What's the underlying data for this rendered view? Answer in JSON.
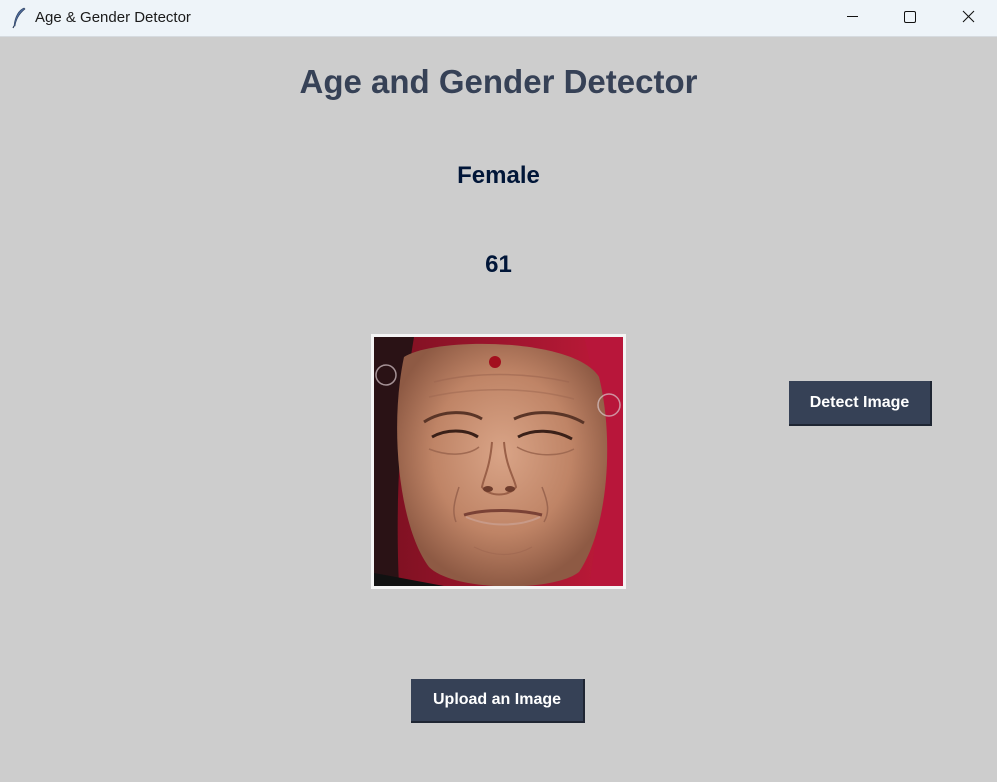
{
  "window": {
    "title": "Age & Gender Detector",
    "icon": "feather-icon",
    "controls": [
      "minimize-icon",
      "maximize-icon",
      "close-icon"
    ]
  },
  "main": {
    "heading": "Age and Gender Detector",
    "gender_result": "Female",
    "age_result": "61",
    "detect_button_label": "Detect Image",
    "upload_button_label": "Upload an Image"
  },
  "colors": {
    "background": "#cdcdcd",
    "heading": "#364156",
    "result_text": "#011638",
    "button_bg": "#364156",
    "button_text": "#ffffff"
  }
}
